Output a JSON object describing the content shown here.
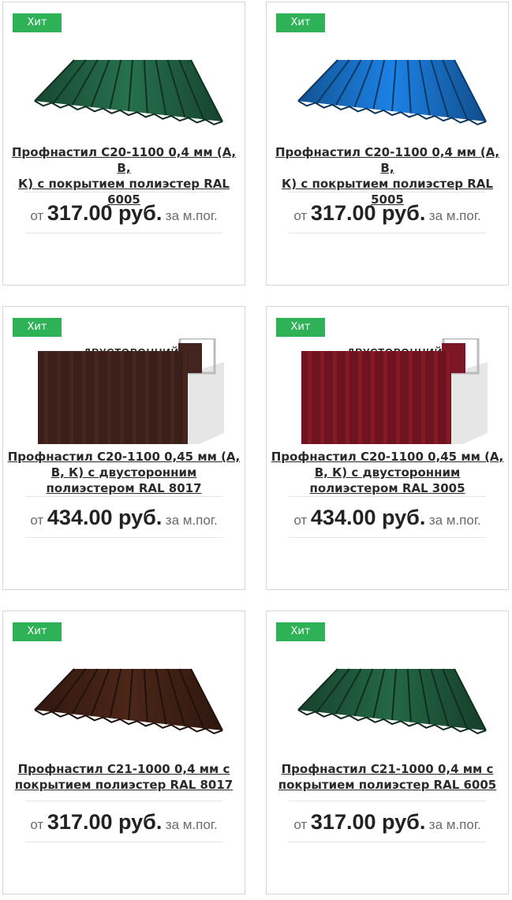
{
  "badge_label": "Хит",
  "price_prefix": "от",
  "price_unit": "за м.пог.",
  "products": [
    {
      "title_lines": [
        "Профнастил С20-1100 0,4 мм (А, В,",
        "К) с покрытием полиэстер RAL",
        "6005"
      ],
      "price": "317.00 руб.",
      "color": "#1e5a3e",
      "image_type": "sheet-wave"
    },
    {
      "title_lines": [
        "Профнастил С20-1100 0,4 мм (А, В,",
        "К) с покрытием полиэстер RAL",
        "5005"
      ],
      "price": "317.00 руб.",
      "color": "#1668b8",
      "image_type": "sheet-wave"
    },
    {
      "title_lines": [
        "Профнастил С20-1100 0,45 мм (А,",
        "В, К) с двусторонним",
        "полиэстером RAL 8017"
      ],
      "price": "434.00 руб.",
      "color": "#3b1f1a",
      "image_type": "double-sided",
      "image_label": "ДВУСТОРОННИЙ"
    },
    {
      "title_lines": [
        "Профнастил С20-1100 0,45 мм (А,",
        "В, К) с двусторонним",
        "полиэстером RAL 3005"
      ],
      "price": "434.00 руб.",
      "color": "#6d1420",
      "image_type": "double-sided",
      "image_label": "ДВУСТОРОННИЙ"
    },
    {
      "title_lines": [
        "Профнастил С21-1000 0,4 мм с",
        "покрытием полиэстер RAL 8017"
      ],
      "price": "317.00 руб.",
      "color": "#3d1e14",
      "image_type": "sheet-wave"
    },
    {
      "title_lines": [
        "Профнастил С21-1000 0,4 мм с",
        "покрытием полиэстер RAL 6005"
      ],
      "price": "317.00 руб.",
      "color": "#1d5338",
      "image_type": "sheet-wave"
    }
  ]
}
